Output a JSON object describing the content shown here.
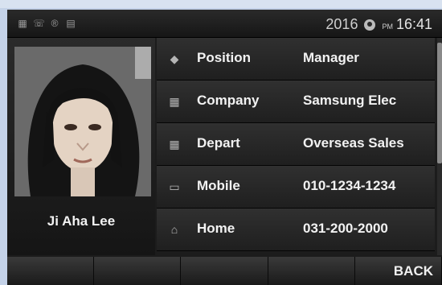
{
  "status": {
    "year": "2016",
    "ampm": "PM",
    "time": "16:41",
    "icons": [
      "network-icon",
      "phone-icon",
      "r-icon",
      "message-icon"
    ]
  },
  "contact": {
    "name": "Ji Aha Lee",
    "rows": [
      {
        "icon": "position-icon",
        "label": "Position",
        "value": "Manager"
      },
      {
        "icon": "company-icon",
        "label": "Company",
        "value": "Samsung Elec"
      },
      {
        "icon": "depart-icon",
        "label": "Depart",
        "value": "Overseas Sales"
      },
      {
        "icon": "mobile-icon",
        "label": "Mobile",
        "value": "010-1234-1234"
      },
      {
        "icon": "home-icon",
        "label": "Home",
        "value": "031-200-2000"
      }
    ]
  },
  "softkeys": [
    "",
    "",
    "",
    "",
    "BACK"
  ]
}
